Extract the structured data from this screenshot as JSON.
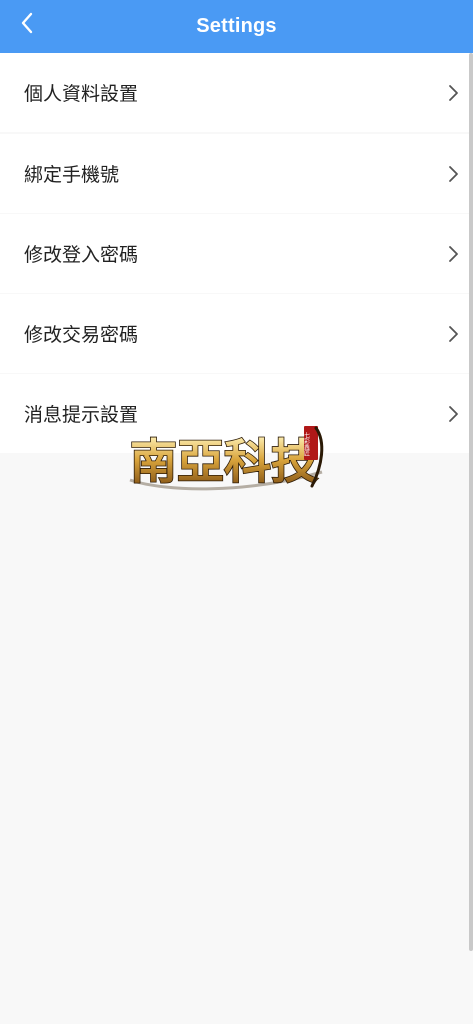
{
  "header": {
    "title": "Settings",
    "back_icon": "chevron-left-icon",
    "background": "#4a9af4"
  },
  "settings_items": [
    {
      "label": "個人資料設置",
      "icon": "chevron-right-icon"
    },
    {
      "label": "綁定手機號",
      "icon": "chevron-right-icon"
    },
    {
      "label": "修改登入密碼",
      "icon": "chevron-right-icon"
    },
    {
      "label": "修改交易密碼",
      "icon": "chevron-right-icon"
    },
    {
      "label": "消息提示設置",
      "icon": "chevron-right-icon"
    }
  ],
  "watermark": {
    "text": "南亞科技",
    "seal": "七彩鑫匠"
  },
  "colors": {
    "page_background": "#f8f8f8",
    "row_background": "#ffffff",
    "text": "#222222",
    "chevron": "#555555"
  }
}
